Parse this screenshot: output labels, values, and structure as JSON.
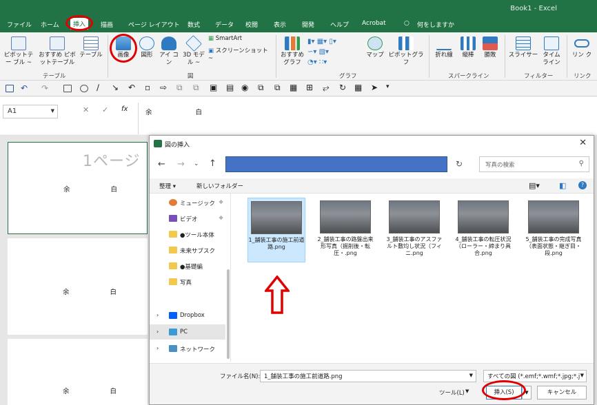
{
  "app": {
    "title": "Book1 - Excel"
  },
  "tabs": [
    "ファイル",
    "ホーム",
    "挿入",
    "描画",
    "ページ レイアウト",
    "数式",
    "データ",
    "校閲",
    "表示",
    "開発",
    "ヘルプ",
    "Acrobat",
    "何をしますか"
  ],
  "ribbon": {
    "buttons": {
      "pivot": "ピボットテー ブル ~",
      "recommended_pivot": "おすすめ ピボットテーブル",
      "table": "テーブル",
      "image": "画像",
      "shapes": "図形",
      "icons": "アイ コン",
      "models3d": "3D モデル ~",
      "smartart": "SmartArt",
      "screenshot": "スクリーンショット ~",
      "recommended_charts": "おすすめ グラフ",
      "map": "マップ",
      "pivot_chart": "ピボットグラフ",
      "sparkline_line": "折れ線",
      "sparkline_column": "縦棒",
      "sparkline_winloss": "勝敗",
      "slicer": "スライサー",
      "timeline": "タイム ライン",
      "link": "リン ク"
    },
    "groups": [
      "テーブル",
      "図",
      "グラフ",
      "スパークライン",
      "フィルター",
      "リンク"
    ]
  },
  "formula_bar": {
    "name_box": "A1",
    "fx": "fx",
    "value": "余 白"
  },
  "sheet": {
    "cells": [
      "余 白",
      "余 白",
      "余 白"
    ],
    "watermark": "1ページ"
  },
  "dialog": {
    "title": "図の挿入",
    "search_placeholder": "写真の検索",
    "organize": "整理 ▾",
    "new_folder": "新しいフォルダー",
    "nav_items": [
      "ミュージック",
      "ビデオ",
      "●ツール本体",
      "未来サブスク",
      "●基礎編",
      "写真",
      "Dropbox",
      "PC",
      "ネットワーク"
    ],
    "files": [
      "1_舗装工事の施工前道路.png",
      "2_舗装工事の路盤出来形写真（掘削後・転圧・.png",
      "3_舗装工事のアスファルト敷均し状況（フィニ.png",
      "4_舗装工事の転圧状況（ローラー・締まり具合.png",
      "5_舗装工事の完成写真（表面状態・継ぎ目・段.png"
    ],
    "filename_label": "ファイル名(N):",
    "filename_value": "1_舗装工事の施工前道路.png",
    "filetype": "すべての図 (*.emf;*.wmf;*.jpg;*.j",
    "tools": "ツール(L)",
    "insert_button": "挿入(S)",
    "cancel_button": "キャンセル"
  },
  "colors": {
    "excel_green": "#217346",
    "annotation_red": "#e00000",
    "address_blue": "#4472c4"
  }
}
